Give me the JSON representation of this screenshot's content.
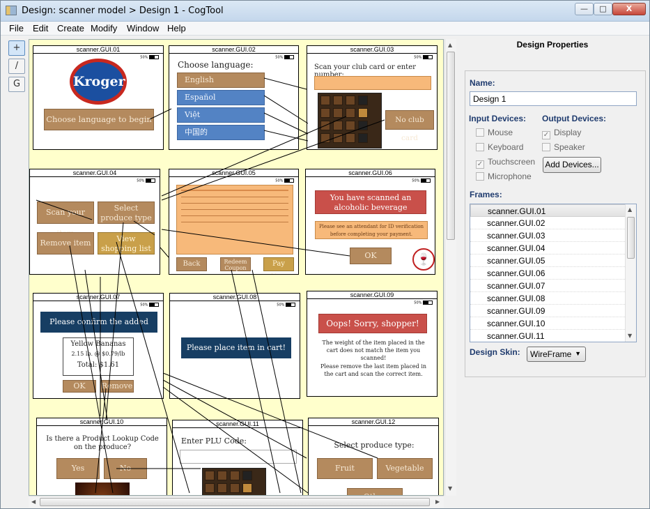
{
  "window": {
    "title": "Design: scanner model > Design 1 - CogTool",
    "controls": {
      "minimize": "—",
      "maximize": "□",
      "close": "X"
    }
  },
  "menu": [
    "File",
    "Edit",
    "Create",
    "Modify",
    "Window",
    "Help"
  ],
  "tools": [
    {
      "name": "select-tool",
      "glyph": "+"
    },
    {
      "name": "transition-tool",
      "glyph": "/"
    },
    {
      "name": "frame-tool",
      "glyph": "G"
    }
  ],
  "frames": {
    "f01": {
      "title": "scanner.GUI.01",
      "battery": "50%",
      "logo": "Kroger",
      "button": "Choose language to begin"
    },
    "f02": {
      "title": "scanner.GUI.02",
      "battery": "50%",
      "heading": "Choose language:",
      "options": [
        "English",
        "Español",
        "Việt",
        "中国的"
      ]
    },
    "f03": {
      "title": "scanner.GUI.03",
      "battery": "50%",
      "heading": "Scan your club card or enter number:",
      "button": "No club card"
    },
    "f04": {
      "title": "scanner.GUI.04",
      "battery": "50%",
      "buttons": [
        "Scan your item",
        "Select produce type",
        "Remove item",
        "View shopping list"
      ]
    },
    "f05": {
      "title": "scanner.GUI.05",
      "battery": "50%",
      "buttons": [
        "Back",
        "Redeem Coupon",
        "Pay Now"
      ]
    },
    "f06": {
      "title": "scanner.GUI.06",
      "battery": "50%",
      "alert": "You have scanned an alcoholic beverage",
      "notice": "Please see an attendant for ID verification before completing your payment.",
      "button": "OK"
    },
    "f07": {
      "title": "scanner.GUI.07",
      "battery": "50%",
      "heading": "Please confirm the added item:",
      "item": "Yellow Bananas",
      "detail": "2.15 lb. @ $0.79/lb",
      "total": "Total: $1.61",
      "buttons": [
        "OK",
        "Remove"
      ]
    },
    "f08": {
      "title": "scanner.GUI.08",
      "battery": "50%",
      "message": "Please place item in cart!"
    },
    "f09": {
      "title": "scanner.GUI.09",
      "battery": "50%",
      "alert": "Oops! Sorry, shopper!",
      "p1": "The weight of the item placed in the cart does not match the item you scanned!",
      "p2": "Please remove the last item placed in the cart and scan the correct item."
    },
    "f10": {
      "title": "scanner.GUI.10",
      "battery": "50%",
      "question": "Is there a Product Lookup Code on the produce?",
      "buttons": [
        "Yes",
        "No"
      ]
    },
    "f11": {
      "title": "scanner.GUI.11",
      "battery": "50%",
      "heading": "Enter PLU Code:"
    },
    "f12": {
      "title": "scanner.GUI.12",
      "battery": "50%",
      "heading": "Select produce type:",
      "buttons": [
        "Fruit",
        "Vegetable",
        "Other"
      ]
    }
  },
  "panel": {
    "title": "Design Properties",
    "name_label": "Name:",
    "name_value": "Design 1",
    "input_label": "Input Devices:",
    "output_label": "Output Devices:",
    "inputs": [
      {
        "label": "Mouse",
        "checked": false
      },
      {
        "label": "Keyboard",
        "checked": false
      },
      {
        "label": "Touchscreen",
        "checked": true
      },
      {
        "label": "Microphone",
        "checked": false
      }
    ],
    "outputs": [
      {
        "label": "Display",
        "checked": true
      },
      {
        "label": "Speaker",
        "checked": false
      }
    ],
    "add_devices": "Add Devices...",
    "frames_label": "Frames:",
    "frame_list": [
      "scanner.GUI.01",
      "scanner.GUI.02",
      "scanner.GUI.03",
      "scanner.GUI.04",
      "scanner.GUI.05",
      "scanner.GUI.06",
      "scanner.GUI.07",
      "scanner.GUI.08",
      "scanner.GUI.09",
      "scanner.GUI.10",
      "scanner.GUI.11"
    ],
    "skin_label": "Design Skin:",
    "skin_value": "WireFrame"
  }
}
